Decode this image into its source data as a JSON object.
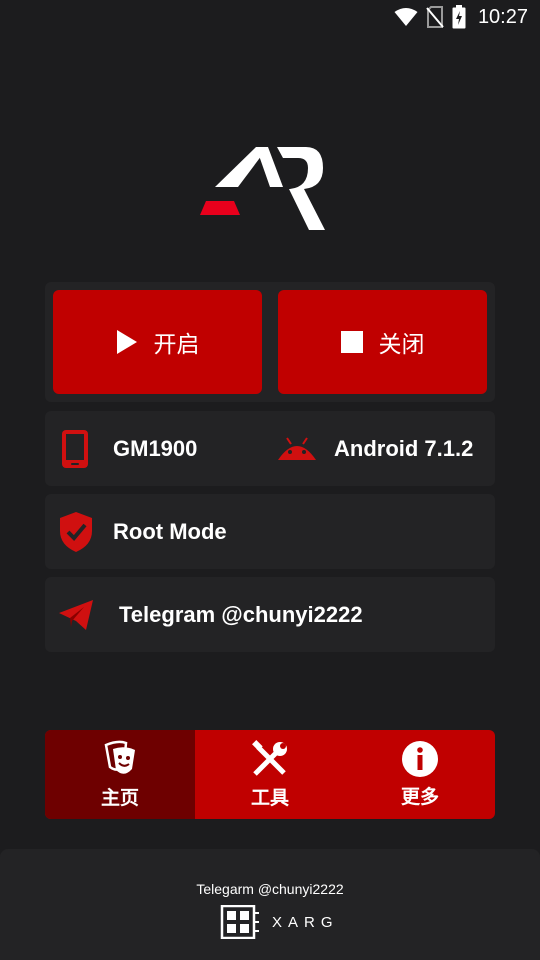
{
  "status_bar": {
    "time": "10:27",
    "icons": [
      "wifi-icon",
      "no-sim-icon",
      "battery-charging-icon"
    ]
  },
  "logo": {
    "name": "ar-logo-icon",
    "accent": "#e8001c"
  },
  "controls": {
    "start_label": "开启",
    "stop_label": "关闭",
    "start_icon": "play-icon",
    "stop_icon": "stop-icon"
  },
  "device": {
    "model": "GM1900",
    "os": "Android 7.1.2",
    "model_icon": "phone-icon",
    "os_icon": "android-icon"
  },
  "root": {
    "label": "Root Mode",
    "icon": "shield-check-icon"
  },
  "telegram": {
    "label": "Telegram @chunyi2222",
    "icon": "telegram-icon"
  },
  "nav": {
    "items": [
      {
        "label": "主页",
        "icon": "theater-mask-icon",
        "active": true
      },
      {
        "label": "工具",
        "icon": "tools-icon",
        "active": false
      },
      {
        "label": "更多",
        "icon": "info-icon",
        "active": false
      }
    ]
  },
  "footer": {
    "text": "Telegarm @chunyi2222",
    "brand": "XARG",
    "brand_icon": "xarg-logo-icon"
  },
  "colors": {
    "background": "#1c1c1e",
    "card": "#232325",
    "accent": "#c00000",
    "accent_dark": "#6e0000"
  }
}
